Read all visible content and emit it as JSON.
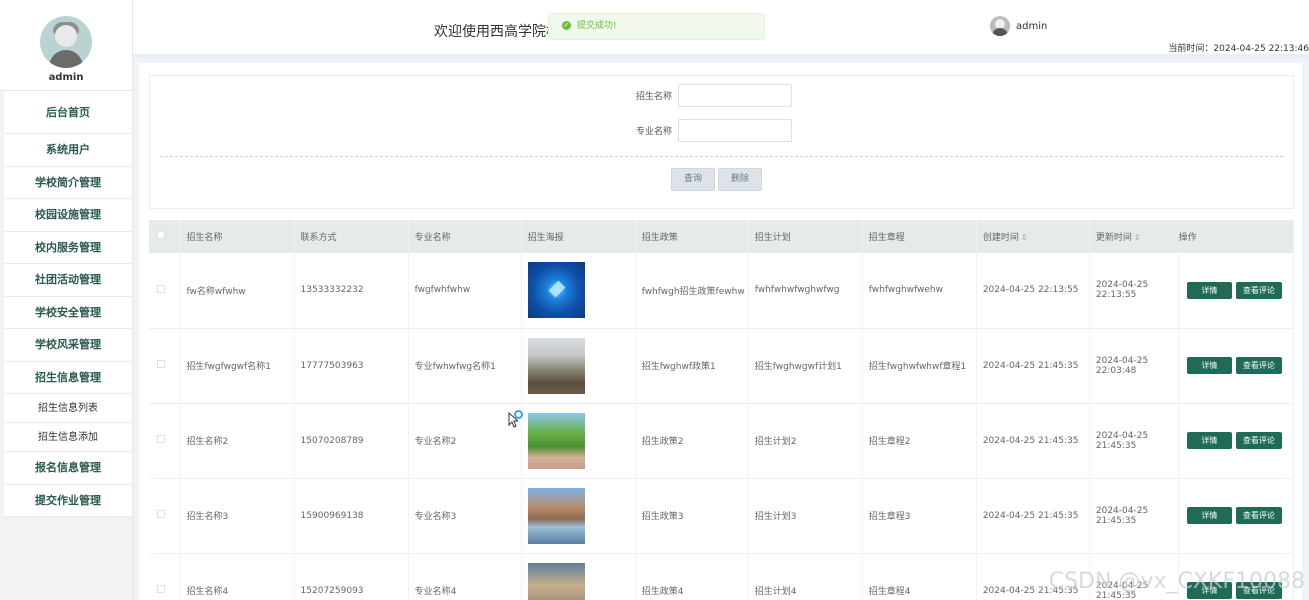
{
  "sidebar": {
    "username": "admin",
    "menu": [
      "后台首页",
      "系统用户",
      "学校简介管理",
      "校园设施管理",
      "校内服务管理",
      "社团活动管理",
      "学校安全管理",
      "学校风采管理",
      "招生信息管理"
    ],
    "sub_menu": [
      "招生信息列表",
      "招生信息添加"
    ],
    "menu_after": [
      "报名信息管理",
      "提交作业管理"
    ]
  },
  "header": {
    "title": "欢迎使用西高学院校",
    "toast": "提交成功!",
    "username": "admin",
    "clock": "当前时间：2024-04-25 22:13:46"
  },
  "search": {
    "field1_label": "招生名称",
    "field2_label": "专业名称",
    "query_btn": "查询",
    "delete_btn": "删除"
  },
  "table": {
    "columns": [
      "招生名称",
      "联系方式",
      "专业名称",
      "招生海报",
      "招生政策",
      "招生计划",
      "招生章程",
      "创建时间",
      "更新时间",
      "操作"
    ],
    "detail_btn": "详情",
    "review_btn": "查看评论",
    "rows": [
      {
        "name": "fw名称wfwhw",
        "phone": "13533332232",
        "major": "fwgfwhfwhw",
        "policy": "fwhfwgh招生政策fewhw",
        "plan": "fwhfwhwfwghwfwg",
        "charter": "fwhfwghwfwehw",
        "created": "2024-04-25 22:13:55",
        "updated": "2024-04-25 22:13:55"
      },
      {
        "name": "招生fwgfwgwf名称1",
        "phone": "17777503963",
        "major": "专业fwhwfwg名称1",
        "policy": "招生fwghwf政策1",
        "plan": "招生fwghwgwf计划1",
        "charter": "招生fwghwfwhwf章程1",
        "created": "2024-04-25 21:45:35",
        "updated": "2024-04-25 22:03:48"
      },
      {
        "name": "招生名称2",
        "phone": "15070208789",
        "major": "专业名称2",
        "policy": "招生政策2",
        "plan": "招生计划2",
        "charter": "招生章程2",
        "created": "2024-04-25 21:45:35",
        "updated": "2024-04-25 21:45:35"
      },
      {
        "name": "招生名称3",
        "phone": "15900969138",
        "major": "专业名称3",
        "policy": "招生政策3",
        "plan": "招生计划3",
        "charter": "招生章程3",
        "created": "2024-04-25 21:45:35",
        "updated": "2024-04-25 21:45:35"
      },
      {
        "name": "招生名称4",
        "phone": "15207259093",
        "major": "专业名称4",
        "policy": "招生政策4",
        "plan": "招生计划4",
        "charter": "招生章程4",
        "created": "2024-04-25 21:45:35",
        "updated": "2024-04-25 21:45:35"
      }
    ]
  },
  "watermark": "CSDN @vx_CXKF10088"
}
